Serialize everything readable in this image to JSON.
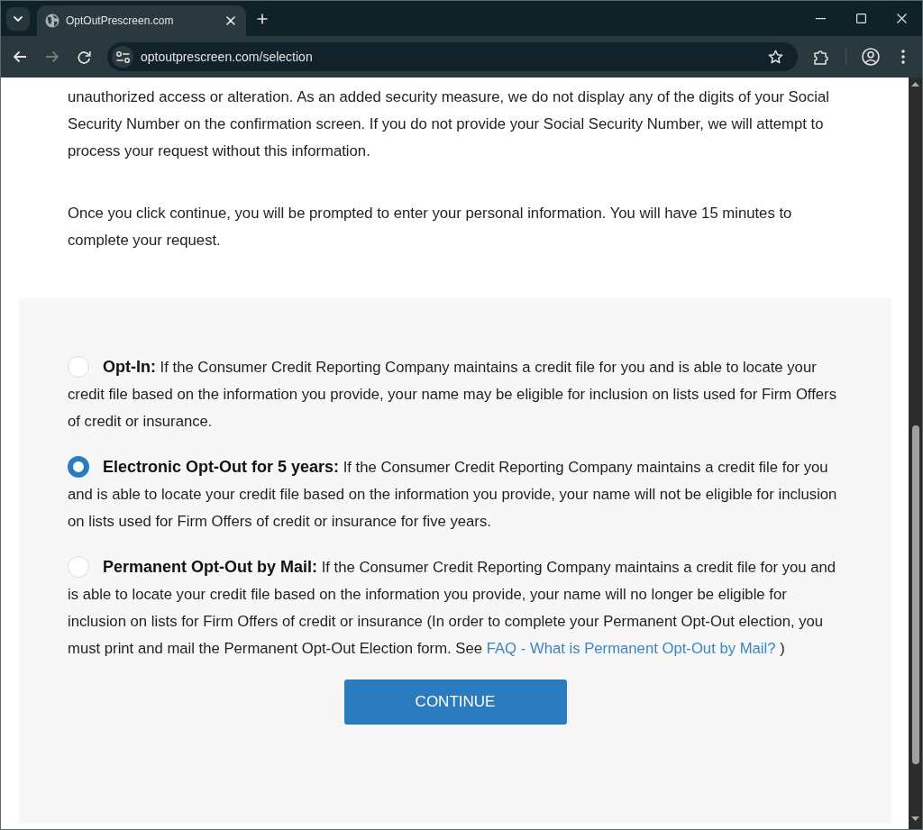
{
  "browser": {
    "tabs": [
      {
        "title": "OptOutPrescreen.com",
        "selected": true
      }
    ],
    "navigation": {
      "back_disabled": false,
      "forward_disabled": true
    },
    "address_bar": {
      "url": "optoutprescreen.com/selection"
    }
  },
  "intro": {
    "paragraphs": [
      "unauthorized access or alteration. As an added security measure, we do not display any of the digits of your Social Security Number on the confirmation screen. If you do not provide your Social Security Number, we will attempt to process your request without this information.",
      "Once you click continue, you will be prompted to enter your personal information. You will have 15 minutes to complete your request."
    ]
  },
  "options": [
    {
      "title": "Opt-In:",
      "text": "If the Consumer Credit Reporting Company maintains a credit file for you and is able to locate your credit file based on the information you provide, your name may be eligible for inclusion on lists used for Firm Offers of credit or insurance.",
      "selected": false
    },
    {
      "title": "Electronic Opt-Out for 5 years:",
      "text": "If the Consumer Credit Reporting Company maintains a credit file for you and is able to locate your credit file based on the information you provide, your name will not be eligible for inclusion on lists used for Firm Offers of credit or insurance for five years.",
      "selected": true
    },
    {
      "title": "Permanent Opt-Out by Mail:",
      "text": "If the Consumer Credit Reporting Company maintains a credit file for you and is able to locate your credit file based on the information you provide, your name will no longer be eligible for inclusion on lists for Firm Offers of credit or insurance (In order to complete your Permanent Opt-Out election, you must print and mail the Permanent Opt-Out Election form. See",
      "link": "FAQ - What is Permanent Opt-Out by Mail?",
      "text_after": ")",
      "selected": false
    }
  ],
  "continue_button": {
    "label": "CONTINUE"
  }
}
